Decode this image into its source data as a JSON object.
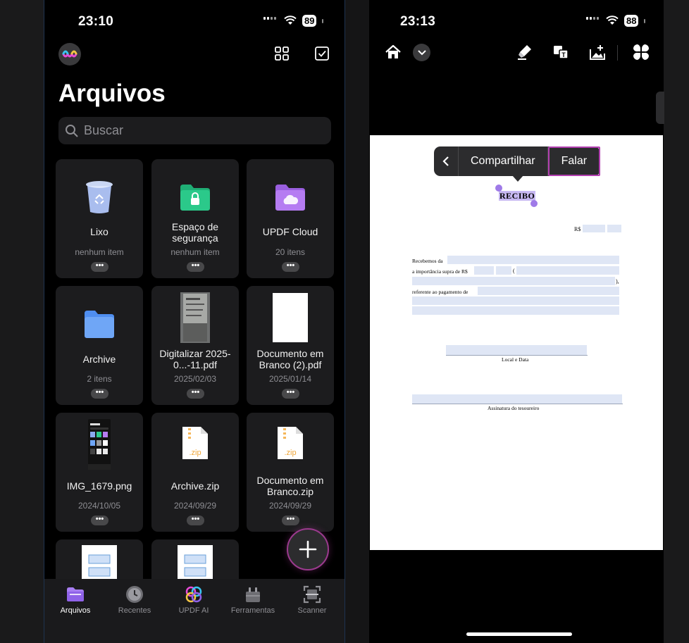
{
  "left_phone": {
    "status": {
      "time": "23:10",
      "battery": "89"
    },
    "title": "Arquivos",
    "search": {
      "placeholder": "Buscar"
    },
    "tiles": [
      {
        "name": "Lixo",
        "meta": "nenhum item",
        "icon": "trash-icon"
      },
      {
        "name": "Espaço de segurança",
        "meta": "nenhum item",
        "icon": "secure-folder-icon"
      },
      {
        "name": "UPDF Cloud",
        "meta": "20 itens",
        "icon": "cloud-folder-icon"
      },
      {
        "name": "Archive",
        "meta": "2 itens",
        "icon": "folder-icon"
      },
      {
        "name": "Digitalizar 2025-0...-11.pdf",
        "meta": "2025/02/03",
        "icon": "scan-thumbnail"
      },
      {
        "name": "Documento em Branco (2).pdf",
        "meta": "2025/01/14",
        "icon": "blank-page-thumbnail"
      },
      {
        "name": "IMG_1679.png",
        "meta": "2024/10/05",
        "icon": "screenshot-thumbnail"
      },
      {
        "name": "Archive.zip",
        "meta": "2024/09/29",
        "icon": "zip-file-icon"
      },
      {
        "name": "Documento em Branco.zip",
        "meta": "2024/09/29",
        "icon": "zip-file-icon"
      }
    ],
    "more_label": "•••",
    "tabs": [
      {
        "label": "Arquivos",
        "icon": "folder-tab-icon",
        "active": true
      },
      {
        "label": "Recentes",
        "icon": "clock-icon",
        "active": false
      },
      {
        "label": "UPDF AI",
        "icon": "ai-icon",
        "active": false
      },
      {
        "label": "Ferramentas",
        "icon": "toolbox-icon",
        "active": false
      },
      {
        "label": "Scanner",
        "icon": "scanner-icon",
        "active": false
      }
    ]
  },
  "right_phone": {
    "status": {
      "time": "23:13",
      "battery": "88"
    },
    "context_menu": {
      "share": "Compartilhar",
      "speak": "Falar"
    },
    "document": {
      "heading": "RECIBO",
      "currency_label": "R$",
      "line1": "Recebemos da",
      "line2": "a importância supra de R$",
      "line2_paren": "(",
      "line3_end": "),",
      "line4": "referente ao pagamento de",
      "location_date": "Local e Data",
      "signature": "Assinatura do tesoureiro"
    }
  },
  "colors": {
    "accent_purple": "#9b3a8e",
    "selection": "#9f7ae8",
    "field_fill": "#dfe6f5"
  }
}
